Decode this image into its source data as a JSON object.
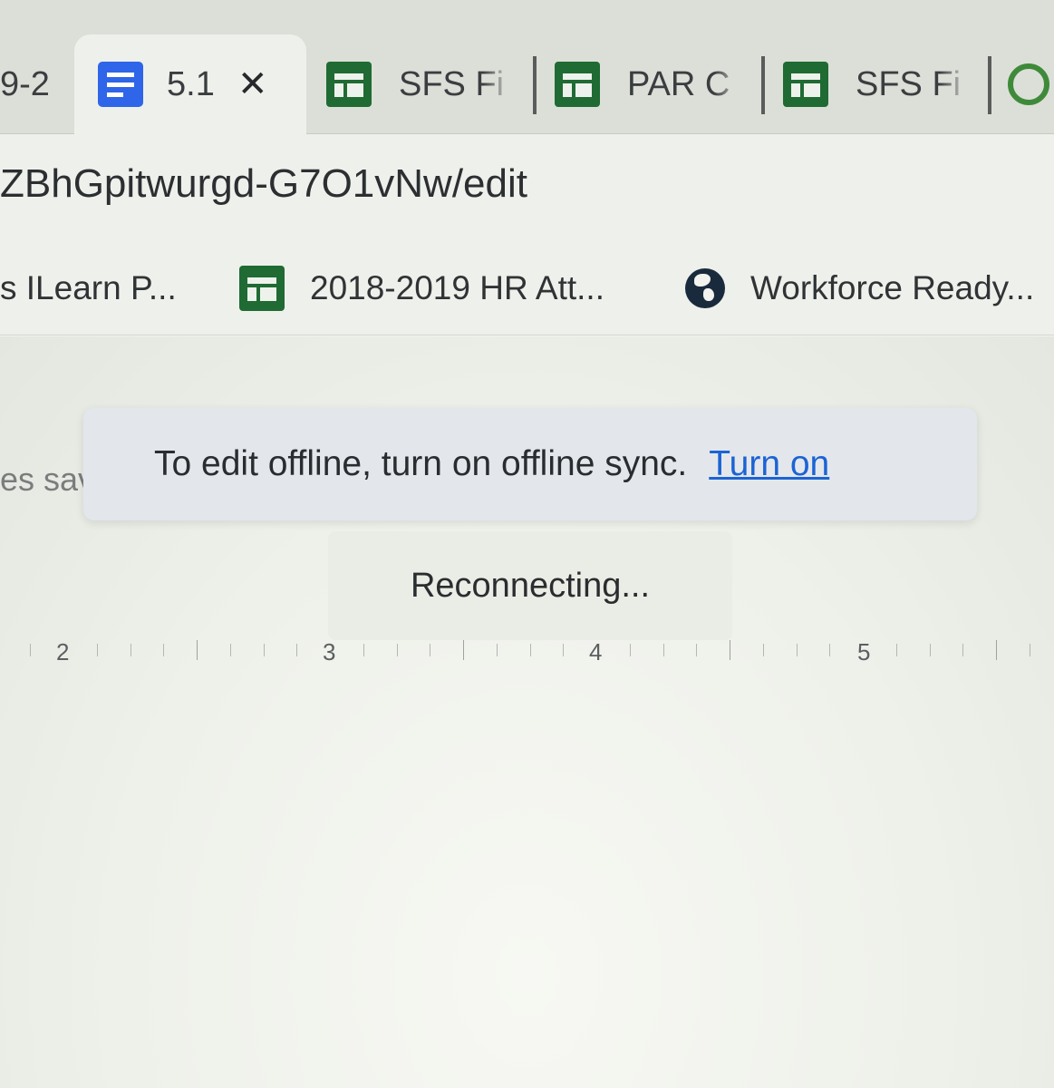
{
  "tabs": [
    {
      "title": "9-2",
      "icon": "none",
      "active": false
    },
    {
      "title": "5.1!",
      "icon": "docs-icon",
      "active": true,
      "close": "✕"
    },
    {
      "title": "SFS Fi",
      "icon": "sheets-icon",
      "active": false
    },
    {
      "title": "PAR C",
      "icon": "sheets-icon",
      "active": false
    },
    {
      "title": "SFS Fi",
      "icon": "sheets-icon",
      "active": false
    }
  ],
  "address": {
    "url": "ZBhGpitwurgd-G7O1vNw/edit"
  },
  "bookmarks": [
    {
      "label": "s ILearn P...",
      "icon": "none"
    },
    {
      "label": "2018-2019 HR Att...",
      "icon": "sheets-icon"
    },
    {
      "label": "Workforce Ready...",
      "icon": "globe-icon"
    }
  ],
  "document": {
    "save_status": "es sav",
    "offline_banner": {
      "message": "To edit offline, turn on offline sync.",
      "action": "Turn on"
    },
    "connection_status": "Reconnecting...",
    "ruler_numbers": [
      "2",
      "3",
      "4",
      "5"
    ]
  },
  "colors": {
    "docs_blue": "#2f65e8",
    "sheets_green": "#1f6b33",
    "link_blue": "#1c63d4",
    "banner_bg": "#e3e7ec"
  }
}
